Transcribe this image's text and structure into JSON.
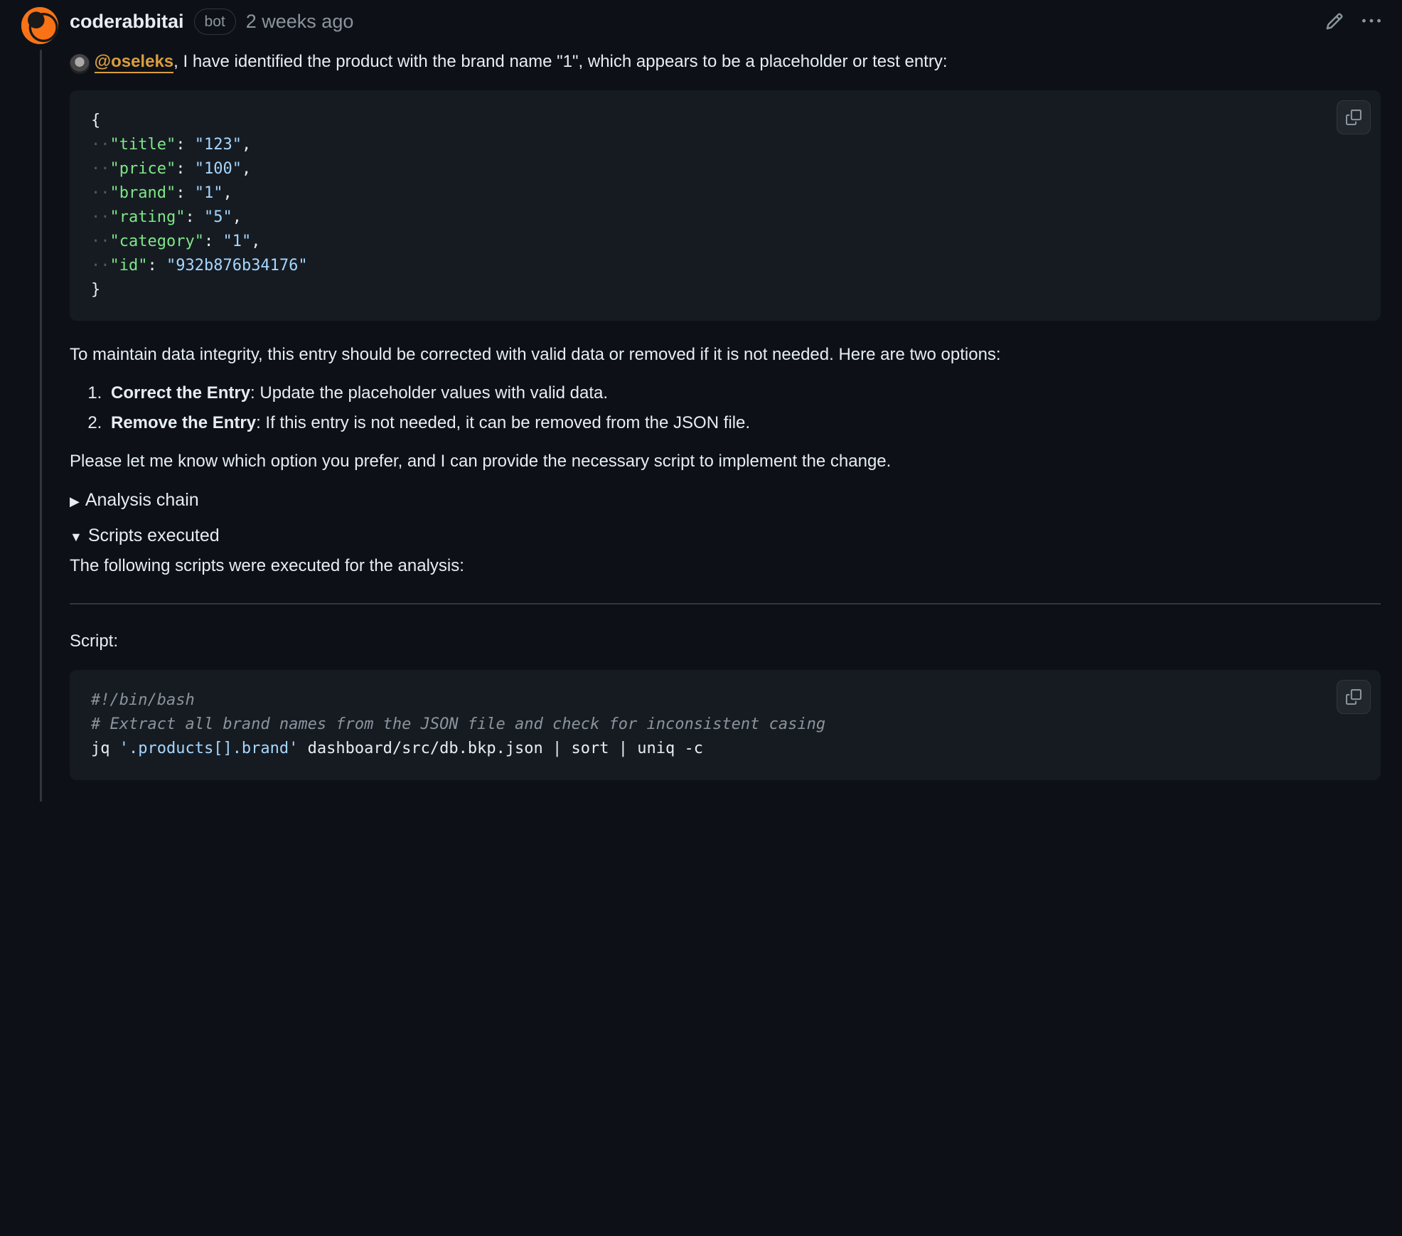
{
  "header": {
    "author": "coderabbitai",
    "badge": "bot",
    "timestamp": "2 weeks ago"
  },
  "body": {
    "mention": "@oseleks",
    "intro_after_mention": ", I have identified the product with the brand name \"1\", which appears to be a placeholder or test entry:",
    "json_sample": {
      "open_brace": "{",
      "close_brace": "}",
      "indent": "··",
      "lines": [
        {
          "key": "\"title\"",
          "val": "\"123\"",
          "trail": ","
        },
        {
          "key": "\"price\"",
          "val": "\"100\"",
          "trail": ","
        },
        {
          "key": "\"brand\"",
          "val": "\"1\"",
          "trail": ","
        },
        {
          "key": "\"rating\"",
          "val": "\"5\"",
          "trail": ","
        },
        {
          "key": "\"category\"",
          "val": "\"1\"",
          "trail": ","
        },
        {
          "key": "\"id\"",
          "val": "\"932b876b34176\"",
          "trail": ""
        }
      ]
    },
    "paragraph2": "To maintain data integrity, this entry should be corrected with valid data or removed if it is not needed. Here are two options:",
    "options": [
      {
        "bold": "Correct the Entry",
        "rest": ": Update the placeholder values with valid data."
      },
      {
        "bold": "Remove the Entry",
        "rest": ": If this entry is not needed, it can be removed from the JSON file."
      }
    ],
    "paragraph3": "Please let me know which option you prefer, and I can provide the necessary script to implement the change.",
    "analysis_chain_label": "Analysis chain",
    "scripts_executed_label": "Scripts executed",
    "scripts_executed_sub": "The following scripts were executed for the analysis:",
    "script_label": "Script:",
    "bash_lines": {
      "shebang": "#!/bin/bash",
      "comment": "# Extract all brand names from the JSON file and check for inconsistent casing",
      "cmd_pre": "jq ",
      "cmd_str": "'.products[].brand'",
      "cmd_post": " dashboard/src/db.bkp.json | sort | uniq -c"
    }
  }
}
